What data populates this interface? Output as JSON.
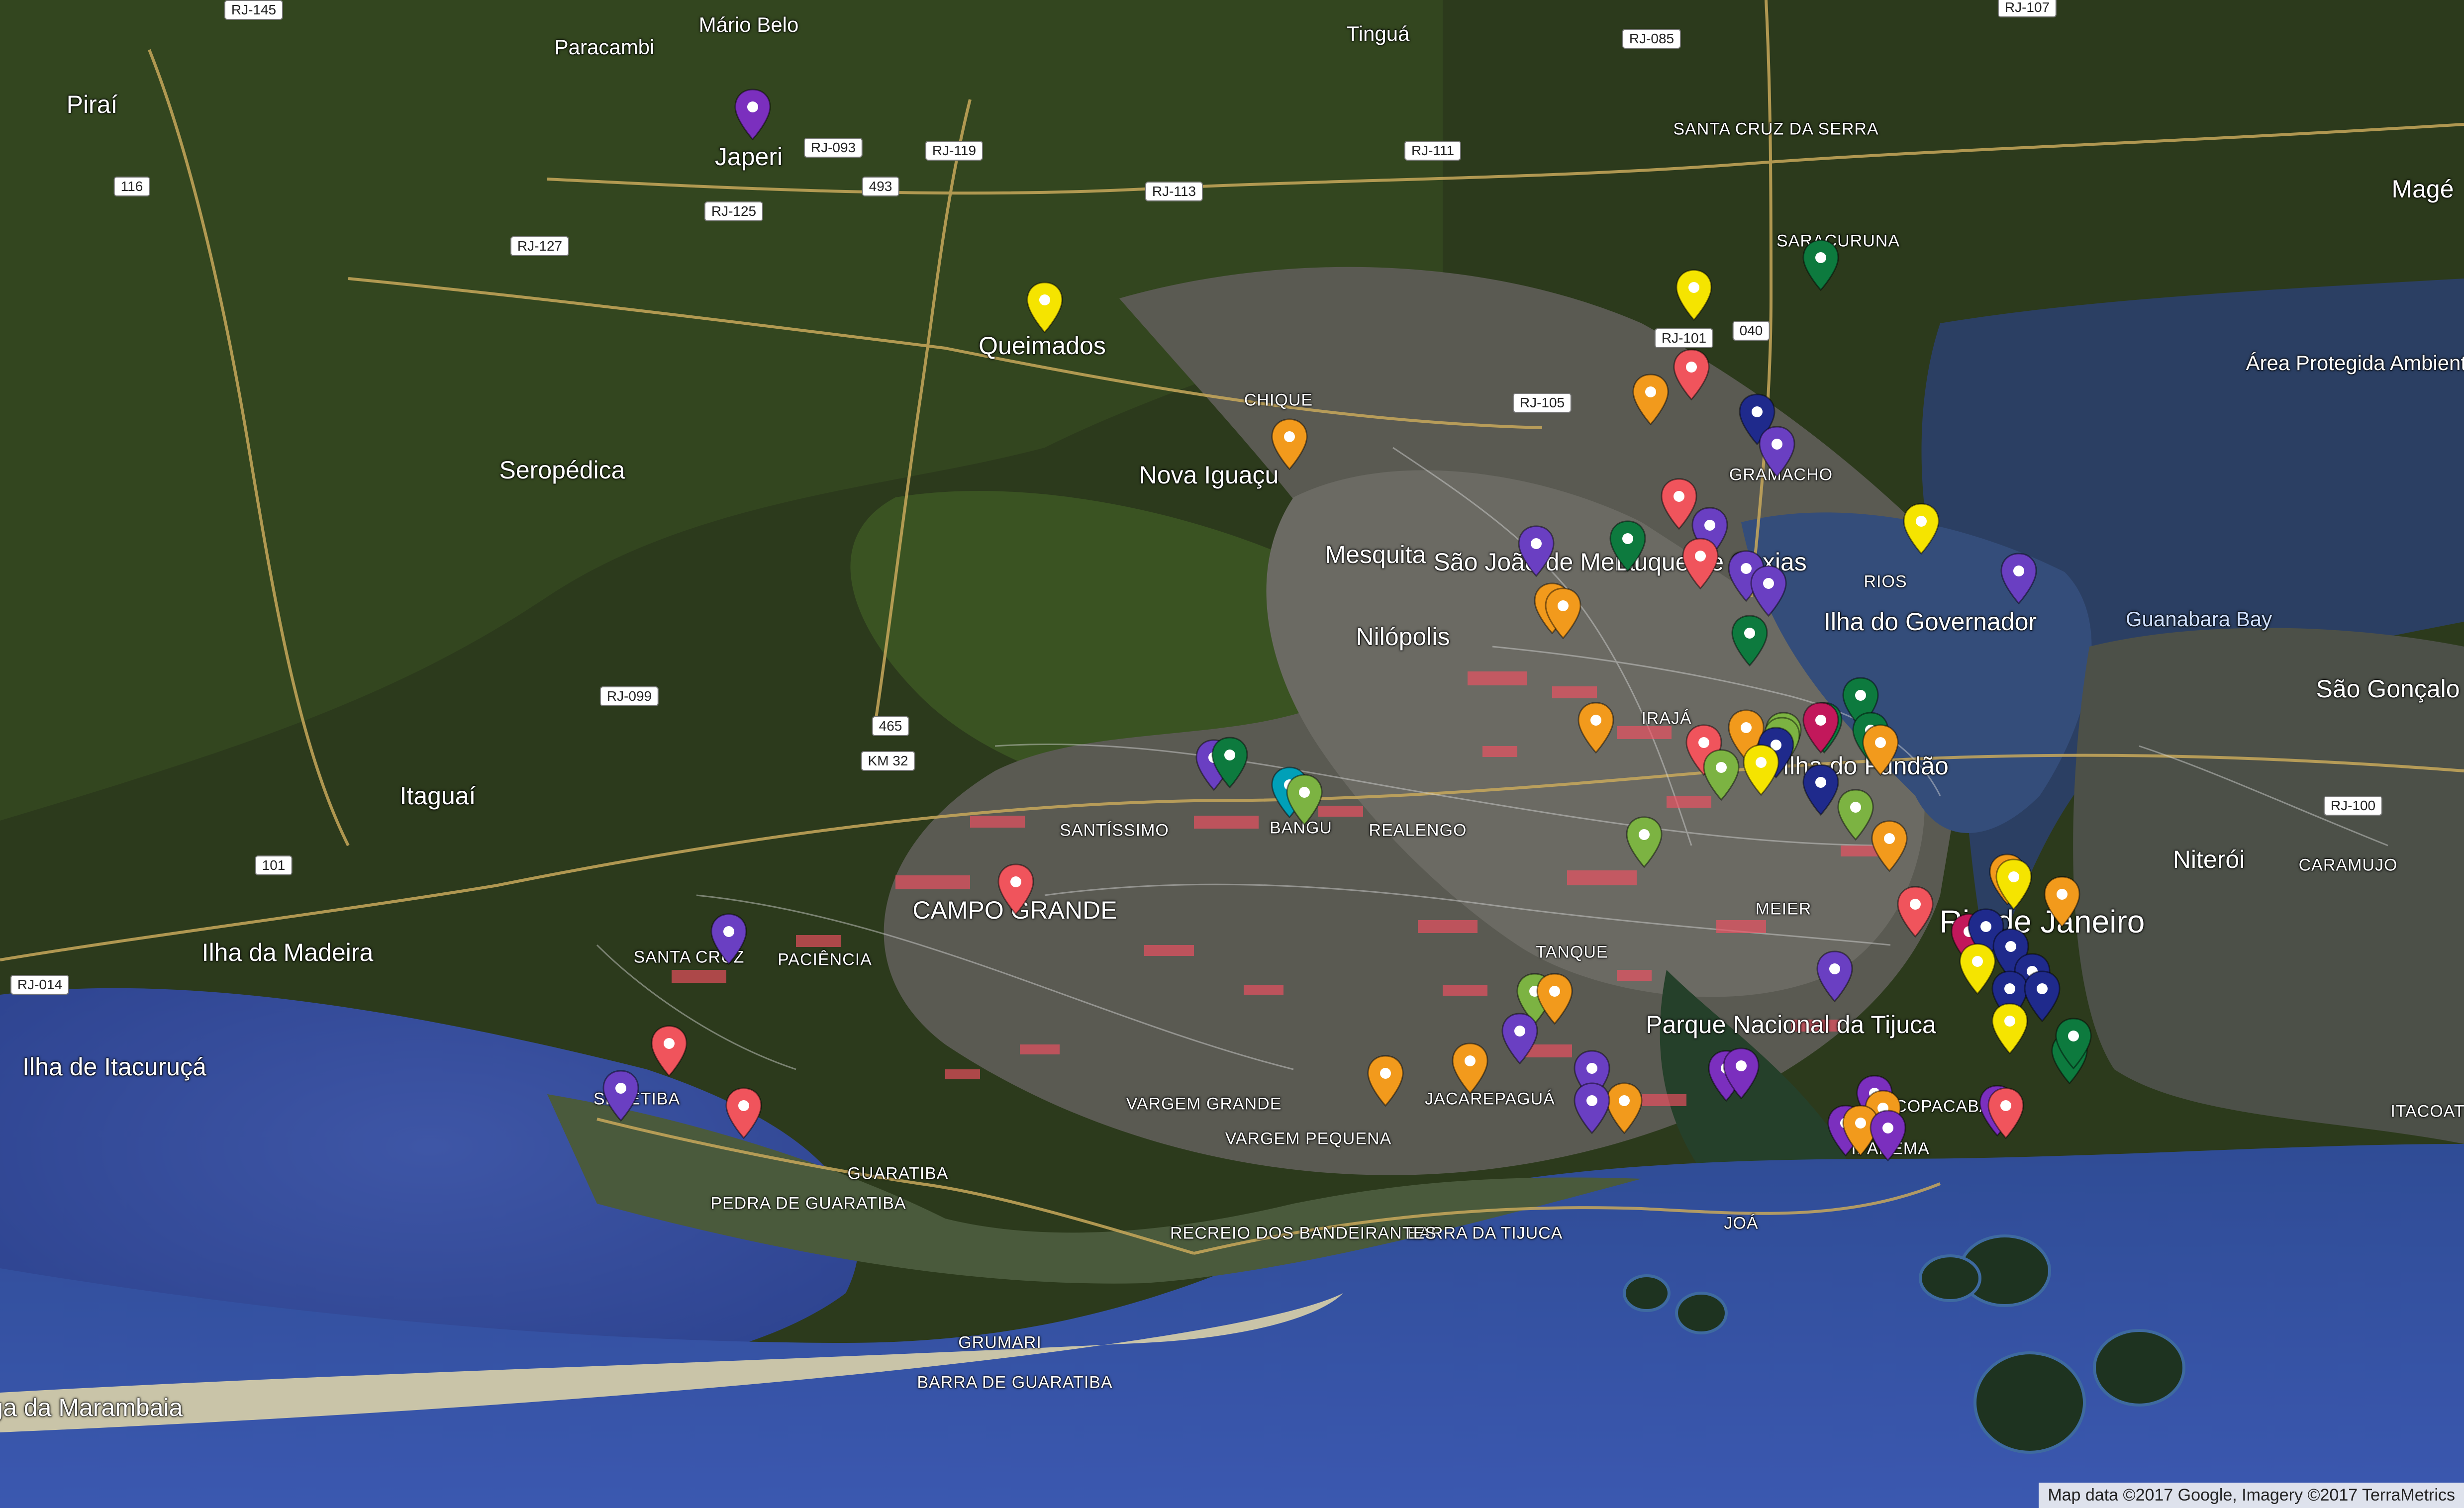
{
  "map": {
    "attribution": "Map data ©2017 Google, Imagery ©2017 TerraMetrics",
    "marker_colors": {
      "purple": "#7b2fbe",
      "violet": "#6a3fc2",
      "yellow": "#f5e400",
      "orange": "#f29a1c",
      "red": "#f0545c",
      "green": "#0d7a3e",
      "lightgreen": "#7cb342",
      "navy": "#1f2a8c",
      "teal": "#00a0b8",
      "crimson": "#c2185b"
    }
  },
  "places": [
    {
      "name": "RJ-145",
      "kind": "shield"
    },
    {
      "name": "Mário Belo",
      "kind": "city-small"
    },
    {
      "name": "Tinguá",
      "kind": "city-small"
    },
    {
      "name": "Paracambi",
      "kind": "city-small"
    },
    {
      "name": "Piraí",
      "kind": "city"
    },
    {
      "name": "Japeri",
      "kind": "city"
    },
    {
      "name": "RJ-093",
      "kind": "shield"
    },
    {
      "name": "RJ-119",
      "kind": "shield"
    },
    {
      "name": "RJ-085",
      "kind": "shield"
    },
    {
      "name": "RJ-107",
      "kind": "shield"
    },
    {
      "name": "SANTA CRUZ DA SERRA",
      "kind": "district"
    },
    {
      "name": "RJ-111",
      "kind": "shield"
    },
    {
      "name": "116",
      "kind": "shield"
    },
    {
      "name": "493",
      "kind": "shield"
    },
    {
      "name": "RJ-113",
      "kind": "shield"
    },
    {
      "name": "RJ-125",
      "kind": "shield"
    },
    {
      "name": "RJ-127",
      "kind": "shield"
    },
    {
      "name": "SARACURUNA",
      "kind": "district"
    },
    {
      "name": "Magé",
      "kind": "city"
    },
    {
      "name": "Queimados",
      "kind": "city"
    },
    {
      "name": "RJ-101",
      "kind": "shield"
    },
    {
      "name": "040",
      "kind": "shield"
    },
    {
      "name": "Área Protegida Ambiental de Guapimirim",
      "kind": "region"
    },
    {
      "name": "CHIQUE",
      "kind": "district"
    },
    {
      "name": "RJ-105",
      "kind": "shield"
    },
    {
      "name": "Nova Iguaçu",
      "kind": "city-large"
    },
    {
      "name": "Seropédica",
      "kind": "city"
    },
    {
      "name": "Mesquita",
      "kind": "city"
    },
    {
      "name": "São João de Meriti",
      "kind": "city-large"
    },
    {
      "name": "Duque de Caxias",
      "kind": "city-large"
    },
    {
      "name": "Nilópolis",
      "kind": "city"
    },
    {
      "name": "GRAMACHO",
      "kind": "district"
    },
    {
      "name": "Ilha do Governador",
      "kind": "city"
    },
    {
      "name": "Guanabara Bay",
      "kind": "water"
    },
    {
      "name": "São Gonçalo",
      "kind": "city"
    },
    {
      "name": "RJ-099",
      "kind": "shield"
    },
    {
      "name": "465",
      "kind": "shield"
    },
    {
      "name": "KM 32",
      "kind": "shield"
    },
    {
      "name": "IRAJÁ",
      "kind": "district"
    },
    {
      "name": "Ilha do Fundão",
      "kind": "city"
    },
    {
      "name": "Itaguaí",
      "kind": "city"
    },
    {
      "name": "101",
      "kind": "shield"
    },
    {
      "name": "SANTÍSSIMO",
      "kind": "district"
    },
    {
      "name": "BANGU",
      "kind": "district"
    },
    {
      "name": "REALENGO",
      "kind": "district"
    },
    {
      "name": "Niterói",
      "kind": "city"
    },
    {
      "name": "CARAMUJO",
      "kind": "district"
    },
    {
      "name": "RJ-100",
      "kind": "shield"
    },
    {
      "name": "Ilha da Madeira",
      "kind": "city"
    },
    {
      "name": "CAMPO GRANDE",
      "kind": "district-large"
    },
    {
      "name": "Rio de Janeiro",
      "kind": "city-xl"
    },
    {
      "name": "MEIER",
      "kind": "district"
    },
    {
      "name": "Ilha de Itacuruçá",
      "kind": "city"
    },
    {
      "name": "SANTA CRUZ",
      "kind": "district"
    },
    {
      "name": "PACIÊNCIA",
      "kind": "district"
    },
    {
      "name": "TANQUE",
      "kind": "district"
    },
    {
      "name": "Parque Nacional da Tijuca",
      "kind": "park"
    },
    {
      "name": "RJ-014",
      "kind": "shield"
    },
    {
      "name": "SEPETIBA",
      "kind": "district"
    },
    {
      "name": "JACAREPAGUÁ",
      "kind": "district"
    },
    {
      "name": "COPACABANA",
      "kind": "district"
    },
    {
      "name": "IPANEMA",
      "kind": "district"
    },
    {
      "name": "ITACOAT",
      "kind": "district"
    },
    {
      "name": "VARGEM GRANDE",
      "kind": "district"
    },
    {
      "name": "VARGEM PEQUENA",
      "kind": "district"
    },
    {
      "name": "GUARATIBA",
      "kind": "district"
    },
    {
      "name": "PEDRA DE GUARATIBA",
      "kind": "district"
    },
    {
      "name": "BARRA DA TIJUCA",
      "kind": "district"
    },
    {
      "name": "RECREIO DOS BANDEIRANTES",
      "kind": "district"
    },
    {
      "name": "JOÁ",
      "kind": "district"
    },
    {
      "name": "GRUMARI",
      "kind": "district"
    },
    {
      "name": "BARRA DE GUARATIBA",
      "kind": "district"
    },
    {
      "name": "Ilha da Restinga da Marambaia",
      "kind": "city"
    },
    {
      "name": "RIOS",
      "kind": "district"
    }
  ],
  "markers": [
    {
      "color": "purple"
    },
    {
      "color": "yellow"
    },
    {
      "color": "green"
    },
    {
      "color": "yellow"
    },
    {
      "color": "red"
    },
    {
      "color": "orange"
    },
    {
      "color": "navy"
    },
    {
      "color": "violet"
    },
    {
      "color": "orange"
    },
    {
      "color": "red"
    },
    {
      "color": "violet"
    },
    {
      "color": "violet"
    },
    {
      "color": "green"
    },
    {
      "color": "red"
    },
    {
      "color": "violet"
    },
    {
      "color": "violet"
    },
    {
      "color": "yellow"
    },
    {
      "color": "violet"
    },
    {
      "color": "orange"
    },
    {
      "color": "orange"
    },
    {
      "color": "green"
    },
    {
      "color": "green"
    },
    {
      "color": "lightgreen"
    },
    {
      "color": "orange"
    },
    {
      "color": "red"
    },
    {
      "color": "orange"
    },
    {
      "color": "green"
    },
    {
      "color": "lightgreen"
    },
    {
      "color": "crimson"
    },
    {
      "color": "green"
    },
    {
      "color": "navy"
    },
    {
      "color": "yellow"
    },
    {
      "color": "navy"
    },
    {
      "color": "orange"
    },
    {
      "color": "violet"
    },
    {
      "color": "green"
    },
    {
      "color": "teal"
    },
    {
      "color": "lightgreen"
    },
    {
      "color": "lightgreen"
    },
    {
      "color": "lightgreen"
    },
    {
      "color": "lightgreen"
    },
    {
      "color": "orange"
    },
    {
      "color": "orange"
    },
    {
      "color": "yellow"
    },
    {
      "color": "orange"
    },
    {
      "color": "red"
    },
    {
      "color": "red"
    },
    {
      "color": "crimson"
    },
    {
      "color": "navy"
    },
    {
      "color": "navy"
    },
    {
      "color": "navy"
    },
    {
      "color": "yellow"
    },
    {
      "color": "navy"
    },
    {
      "color": "navy"
    },
    {
      "color": "yellow"
    },
    {
      "color": "green"
    },
    {
      "color": "violet"
    },
    {
      "color": "violet"
    },
    {
      "color": "red"
    },
    {
      "color": "red"
    },
    {
      "color": "violet"
    },
    {
      "color": "lightgreen"
    },
    {
      "color": "orange"
    },
    {
      "color": "violet"
    },
    {
      "color": "orange"
    },
    {
      "color": "orange"
    },
    {
      "color": "violet"
    },
    {
      "color": "orange"
    },
    {
      "color": "purple"
    },
    {
      "color": "purple"
    },
    {
      "color": "purple"
    },
    {
      "color": "orange"
    },
    {
      "color": "purple"
    },
    {
      "color": "orange"
    },
    {
      "color": "purple"
    },
    {
      "color": "purple"
    },
    {
      "color": "red"
    },
    {
      "color": "violet"
    },
    {
      "color": "green"
    }
  ]
}
